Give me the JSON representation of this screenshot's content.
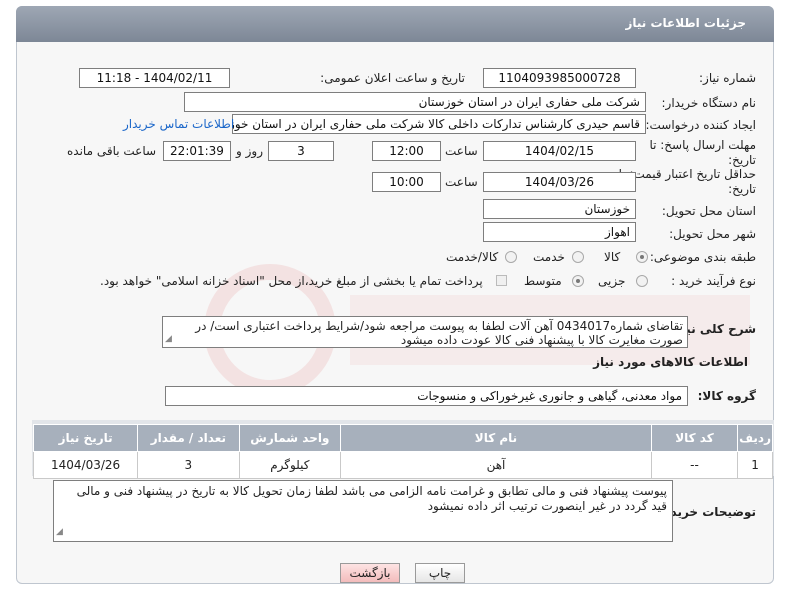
{
  "header": {
    "title": "جزئیات اطلاعات نیاز"
  },
  "form": {
    "need_number": {
      "label": "شماره نیاز:",
      "value": "1104093985000728"
    },
    "announce": {
      "label": "تاریخ و ساعت اعلان عمومی:",
      "value": "1404/02/11 - 11:18"
    },
    "buyer_org": {
      "label": "نام دستگاه خریدار:",
      "value": "شرکت ملی حفاری ایران در استان خوزستان"
    },
    "requester": {
      "label": "ایجاد کننده درخواست:",
      "value": "قاسم حیدری کارشناس تدارکات داخلی کالا شرکت ملی حفاری ایران در استان خوزستان",
      "contact_link": "اطلاعات تماس خریدار"
    },
    "deadline": {
      "label": "مهلت ارسال پاسخ: تا تاریخ:",
      "date": "1404/02/15",
      "time_label": "ساعت",
      "time": "12:00",
      "days": "3",
      "days_label": "روز و",
      "remaining": "22:01:39",
      "remaining_label": "ساعت باقی مانده"
    },
    "validity": {
      "label": "حداقل تاریخ اعتبار قیمت: تا تاریخ:",
      "date": "1404/03/26",
      "time_label": "ساعت",
      "time": "10:00"
    },
    "province": {
      "label": "استان محل تحویل:",
      "value": "خوزستان"
    },
    "city": {
      "label": "شهر محل تحویل:",
      "value": "اهواز"
    },
    "category": {
      "label": "طبقه بندی موضوعی:",
      "options": [
        "کالا",
        "خدمت",
        "کالا/خدمت"
      ],
      "selected": "کالا"
    },
    "purchase_type": {
      "label": "نوع فرآیند خرید :",
      "options": [
        "جزیی",
        "متوسط"
      ],
      "selected": "متوسط",
      "payment_note": "پرداخت تمام یا بخشی از مبلغ خرید،از محل \"اسناد خزانه اسلامی\" خواهد بود."
    }
  },
  "description": {
    "label": "شرح کلی نیاز:",
    "value": "تقاضای شماره0434017 آهن آلات لطفا به پیوست مراجعه شود/شرایط پرداخت اعتباری است/ در صورت مغایرت کالا با پیشنهاد فنی کالا عودت داده میشود"
  },
  "goods_section": {
    "title": "اطلاعات کالاهای مورد نیاز"
  },
  "goods_group": {
    "label": "گروه کالا:",
    "value": "مواد معدنی، گیاهی و جانوری غیرخوراکی و منسوجات"
  },
  "table": {
    "headers": [
      "ردیف",
      "کد کالا",
      "نام کالا",
      "واحد شمارش",
      "تعداد / مقدار",
      "تاریخ نیاز"
    ],
    "rows": [
      [
        "1",
        "--",
        "آهن",
        "کیلوگرم",
        "3",
        "1404/03/26"
      ]
    ]
  },
  "buyer_notes": {
    "label": "توضیحات خریدار:",
    "value": "پیوست پیشنهاد فنی و مالی تطابق و غرامت نامه الزامی می باشد لطفا زمان تحویل کالا به تاریخ در پیشنهاد فنی و مالی قید گردد در غیر اینصورت ترتیب اثر داده نمیشود"
  },
  "buttons": {
    "print": "چاپ",
    "back": "بازگشت"
  },
  "colors": {
    "header_bg": "#8a94a3",
    "link": "#1a66c9",
    "back_btn": "#f7c9c9"
  }
}
